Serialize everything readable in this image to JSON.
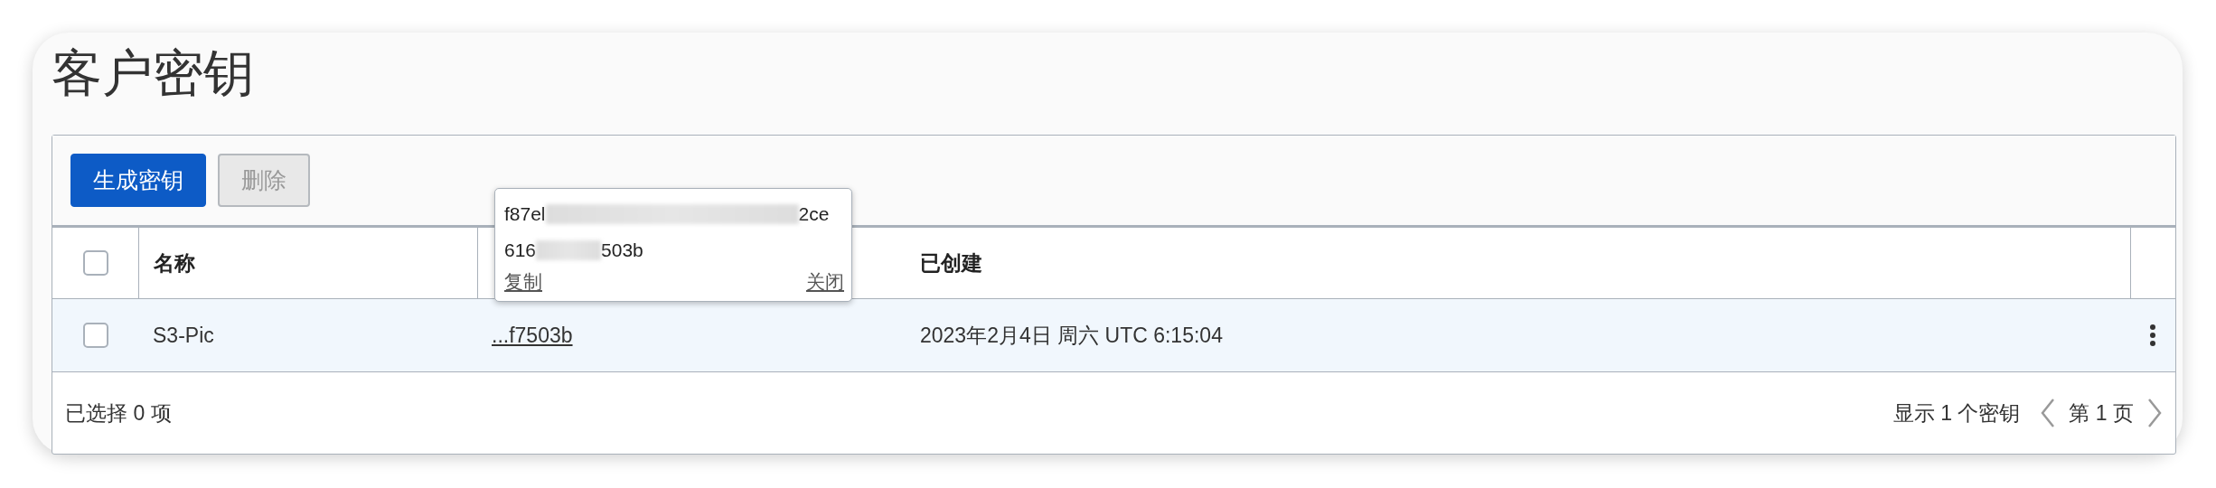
{
  "page": {
    "title": "客户密钥"
  },
  "toolbar": {
    "buttons": [
      {
        "label": "生成密钥",
        "kind": "primary",
        "disabled": false
      },
      {
        "label": "删除",
        "kind": "secondary",
        "disabled": true
      }
    ]
  },
  "table": {
    "header": {
      "checked": false,
      "name_label": "名称",
      "created_label": "已创建"
    },
    "rows": [
      {
        "checked": false,
        "highlighted": true,
        "name": "S3-Pic",
        "key": "...f7503b",
        "created": "2023年2月4日 周六 UTC 6:15:04"
      }
    ]
  },
  "footer": {
    "selection": "已选择 0 项",
    "count": "显示 1 个密钥",
    "page": "第 1 页"
  },
  "popup": {
    "lines": [
      {
        "start": "f87el",
        "end": "2ce"
      },
      {
        "start": "616",
        "end": "503b"
      }
    ],
    "copy": "复制",
    "close": "关闭"
  }
}
